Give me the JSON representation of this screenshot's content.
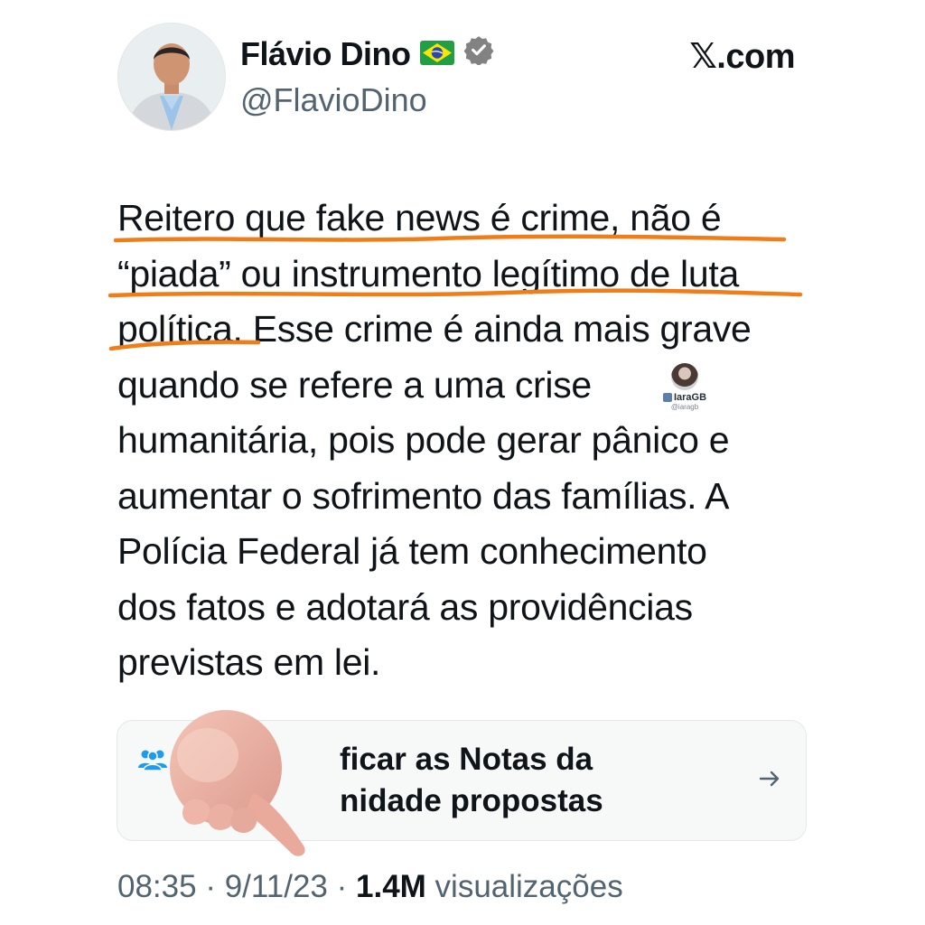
{
  "header": {
    "display_name": "Flávio Dino",
    "flag": "🇧🇷",
    "handle": "@FlavioDino",
    "brand": "𝕏.com"
  },
  "tweet": {
    "lines": [
      "Reitero que fake news é crime, não é",
      "“piada” ou instrumento legítimo de luta",
      "política. Esse crime é ainda mais grave",
      "quando se refere a uma crise",
      "humanitária, pois pode gerar pânico e",
      "aumentar o sofrimento das famílias. A",
      "Polícia Federal já tem conhecimento",
      "dos fatos e adotará as providências",
      "previstas em lei."
    ]
  },
  "watermark": {
    "name": "IaraGB",
    "handle": "@iaragb"
  },
  "notes": {
    "line1": "ficar as Notas da",
    "line2": "nidade propostas"
  },
  "footer": {
    "time": "08:35",
    "date": "9/11/23",
    "views_count": "1.4M",
    "views_label": "visualizações"
  },
  "colors": {
    "underline": "#f07d18",
    "verified": "#828282",
    "secondary_text": "#536471",
    "notes_icon": "#1d9bf0",
    "finger": "#e8ada1"
  }
}
